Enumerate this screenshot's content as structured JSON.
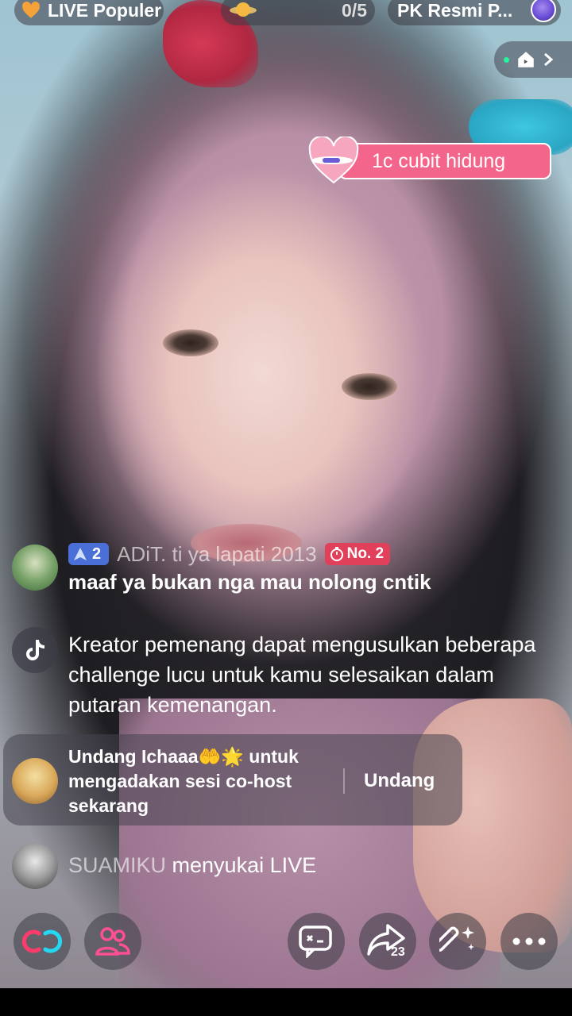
{
  "top_bar": {
    "live_label": "LIVE Populer",
    "fav_count": "0/5",
    "pk_label": "PK Resmi P..."
  },
  "gift_banner": {
    "text": "1c cubit hidung"
  },
  "chat": {
    "comment": {
      "level": "2",
      "username": "ADiT.    ti    ya lapati 2013",
      "rank": "No. 2",
      "text": "maaf ya bukan nga mau nolong cntik"
    },
    "system_message": "Kreator pemenang dapat mengusulkan beberapa challenge lucu untuk kamu selesaikan dalam putaran kemenangan.",
    "invite": {
      "text_before": "Undang Ichaaa",
      "text_after": " untuk mengadakan sesi co-host sekarang",
      "button": "Undang"
    },
    "like_event": {
      "username": "SUAMIKU",
      "action": " menyukai LIVE"
    }
  },
  "toolbar": {
    "share_count": "23"
  },
  "colors": {
    "gift_pink": "#f3658a",
    "level_blue": "#4a6fd6",
    "rank_red": "#e0405a"
  }
}
